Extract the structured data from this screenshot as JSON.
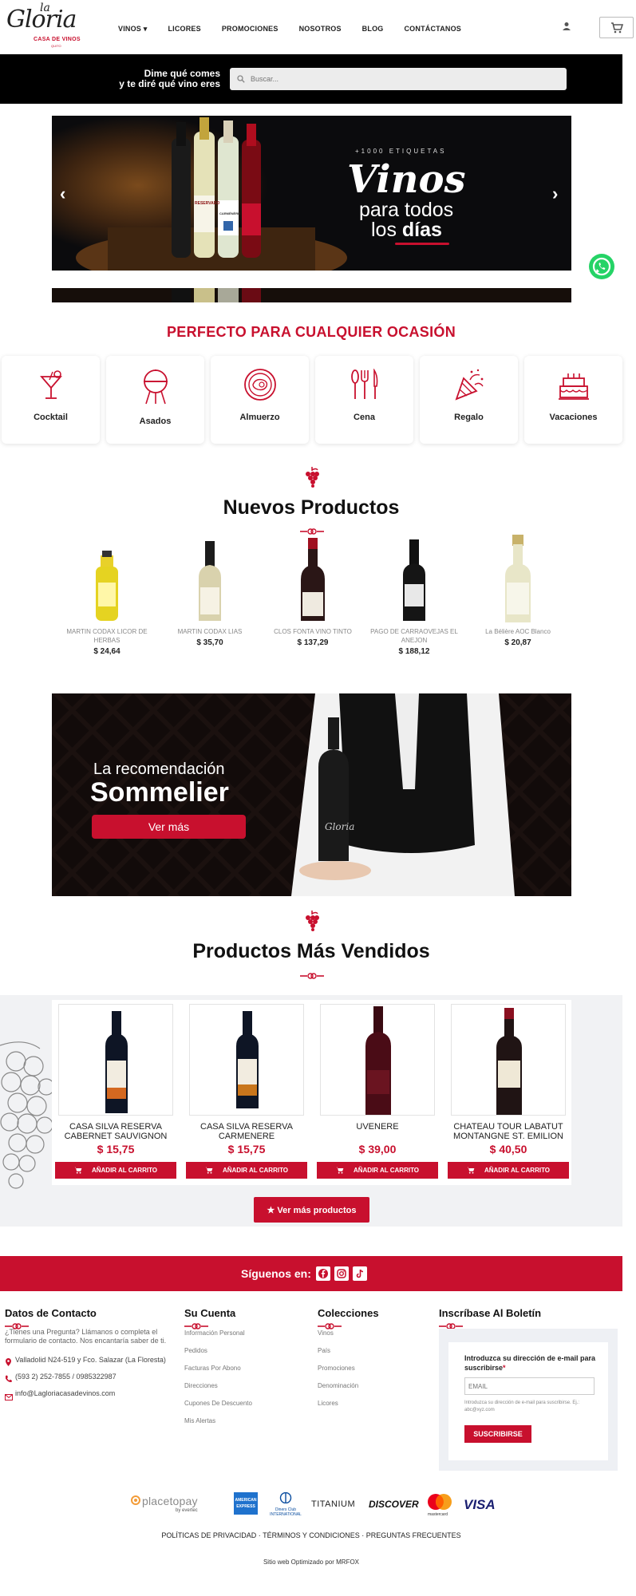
{
  "header": {
    "logo_la": "la",
    "logo_name": "Gloria",
    "logo_sub": "CASA DE VINOS",
    "logo_city": "QUITO",
    "nav": [
      "VINOS ▾",
      "LICORES",
      "PROMOCIONES",
      "NOSOTROS",
      "BLOG",
      "CONTÁCTANOS"
    ]
  },
  "search": {
    "tagline_1": "Dime qué comes",
    "tagline_2": "y te diré qué vino eres",
    "placeholder": "Buscar..."
  },
  "hero": {
    "tag": "+1000 ETIQUETAS",
    "big": "Vinos",
    "line2": "para todos",
    "line3_a": "los ",
    "line3_b": "días",
    "bottle_labels": [
      "RESERVADO",
      "CARMÉNÈRE"
    ]
  },
  "occasions": {
    "title": "PERFECTO PARA CUALQUIER OCASIÓN",
    "items": [
      "Cocktail",
      "Asados",
      "Almuerzo",
      "Cena",
      "Regalo",
      "Vacaciones"
    ]
  },
  "new_products": {
    "title": "Nuevos Productos",
    "items": [
      {
        "name": "MARTIN CODAX LICOR DE HERBAS",
        "price": "$ 24,64"
      },
      {
        "name": "MARTIN CODAX LIAS",
        "price": "$ 35,70"
      },
      {
        "name": "CLOS FONTA VINO TINTO",
        "price": "$ 137,29"
      },
      {
        "name": "PAGO DE CARRAOVEJAS EL ANEJON",
        "price": "$ 188,12"
      },
      {
        "name": "La Bélière AOC Blanco",
        "price": "$ 20,87"
      }
    ]
  },
  "sommelier": {
    "line1": "La recomendación",
    "line2": "Sommelier",
    "button": "Ver más",
    "bottle_label": "Gloria"
  },
  "best_sellers": {
    "title": "Productos Más Vendidos",
    "items": [
      {
        "name": "CASA SILVA RESERVA CABERNET SAUVIGNON",
        "price": "$ 15,75",
        "button": "AÑADIR AL CARRITO"
      },
      {
        "name": "CASA SILVA RESERVA CARMENERE",
        "price": "$ 15,75",
        "button": "AÑADIR AL CARRITO"
      },
      {
        "name": "UVENERE",
        "price": "$ 39,00",
        "button": "AÑADIR AL CARRITO"
      },
      {
        "name": "CHATEAU TOUR LABATUT MONTANGNE ST. EMILION",
        "price": "$ 40,50",
        "button": "AÑADIR AL CARRITO"
      }
    ],
    "more_button": "★ Ver más productos"
  },
  "follow": {
    "label": "Síguenos en:"
  },
  "footer": {
    "contact": {
      "title": "Datos de Contacto",
      "text": "¿Tienes una Pregunta? Llámanos o completa el formulario de contacto. Nos encantaría saber de ti.",
      "address": "Valladolid N24-519 y Fco. Salazar (La Floresta)",
      "phone": "(593 2) 252-7855 / 0985322987",
      "email": "info@Lagloriacasadevinos.com"
    },
    "account": {
      "title": "Su Cuenta",
      "links": [
        "Información Personal",
        "Pedidos",
        "Facturas Por Abono",
        "Direcciones",
        "Cupones De Descuento",
        "Mis Alertas"
      ]
    },
    "collections": {
      "title": "Colecciones",
      "links": [
        "Vinos",
        "País",
        "Promociones",
        "Denominación",
        "Licores"
      ]
    },
    "newsletter": {
      "title": "Inscríbase Al Boletín",
      "label": "Introduzca su dirección de e-mail para suscribirse",
      "required_mark": "*",
      "placeholder": "EMAIL",
      "help": "Introduzca su dirección de e-mail para suscribirse. Ej.: abc@xyz.com",
      "button": "SUSCRIBIRSE"
    },
    "payments": [
      "placetopay",
      "by evertec",
      "AMERICAN EXPRESS",
      "Diners Club INTERNATIONAL",
      "TITANIUM",
      "DISCOVER",
      "mastercard",
      "VISA"
    ],
    "legal": "POLÍTICAS DE PRIVACIDAD · TÉRMINOS Y CONDICIONES · PREGUNTAS FRECUENTES",
    "credit": "Sitio web Optimizado por MRFOX"
  },
  "colors": {
    "brand_red": "#c8102e",
    "black": "#000000",
    "whatsapp_green": "#25d366"
  }
}
